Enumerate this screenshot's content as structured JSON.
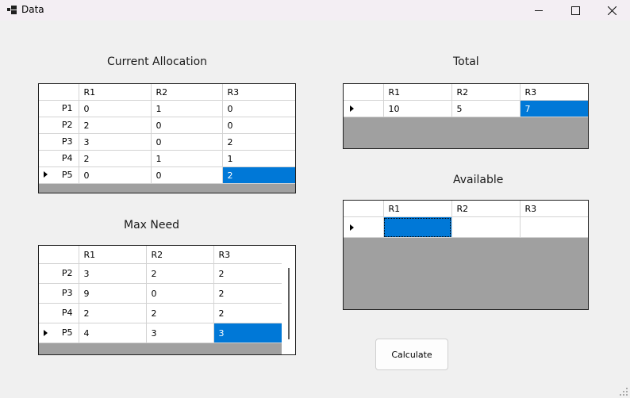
{
  "window": {
    "title": "Data"
  },
  "allocation": {
    "label": "Current Allocation",
    "columns": [
      "R1",
      "R2",
      "R3"
    ],
    "rows": [
      {
        "name": "P1",
        "cells": [
          "0",
          "1",
          "0"
        ]
      },
      {
        "name": "P2",
        "cells": [
          "2",
          "0",
          "0"
        ]
      },
      {
        "name": "P3",
        "cells": [
          "3",
          "0",
          "2"
        ]
      },
      {
        "name": "P4",
        "cells": [
          "2",
          "1",
          "1"
        ]
      },
      {
        "name": "P5",
        "cells": [
          "0",
          "0",
          "2"
        ]
      }
    ]
  },
  "total": {
    "label": "Total",
    "columns": [
      "R1",
      "R2",
      "R3"
    ],
    "rows": [
      {
        "name": "",
        "cells": [
          "10",
          "5",
          "7"
        ]
      }
    ]
  },
  "max_need": {
    "label": "Max Need",
    "columns": [
      "R1",
      "R2",
      "R3"
    ],
    "rows": [
      {
        "name": "P2",
        "cells": [
          "3",
          "2",
          "2"
        ]
      },
      {
        "name": "P3",
        "cells": [
          "9",
          "0",
          "2"
        ]
      },
      {
        "name": "P4",
        "cells": [
          "2",
          "2",
          "2"
        ]
      },
      {
        "name": "P5",
        "cells": [
          "4",
          "3",
          "3"
        ]
      }
    ]
  },
  "available": {
    "label": "Available",
    "columns": [
      "R1",
      "R2",
      "R3"
    ],
    "rows": [
      {
        "name": "",
        "cells": [
          "",
          "",
          ""
        ]
      }
    ]
  },
  "actions": {
    "calculate_label": "Calculate"
  }
}
